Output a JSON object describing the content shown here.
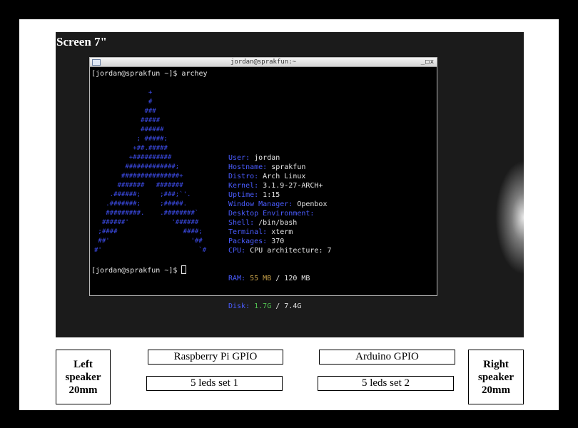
{
  "screen": {
    "label": "Screen 7\""
  },
  "terminal": {
    "title": "jordan@sprakfun:~",
    "controls": {
      "minimize": "_",
      "maximize": "□",
      "close": "x"
    },
    "command_line": "[jordan@sprakfun ~]$ archey",
    "prompt_line": "[jordan@sprakfun ~]$ ",
    "logo_lines": [
      "              +",
      "              #",
      "             ###",
      "            #####",
      "            ######",
      "           ; #####;",
      "          +##.#####",
      "         +##########",
      "        #############;",
      "       ###############+",
      "      #######   #######",
      "    .######;     ;###;`'.",
      "   .#######;     ;#####.",
      "   #########.    .########`",
      "  ######'           '######",
      " ;####                 ####;",
      " ##'                     '##",
      "#'                         `#"
    ],
    "info": [
      {
        "key": "User:",
        "value": "jordan"
      },
      {
        "key": "Hostname:",
        "value": "sprakfun"
      },
      {
        "key": "Distro:",
        "value": "Arch Linux"
      },
      {
        "key": "Kernel:",
        "value": "3.1.9-27-ARCH+"
      },
      {
        "key": "Uptime:",
        "value": "1:15"
      },
      {
        "key": "Window Manager:",
        "value": "Openbox"
      },
      {
        "key": "Desktop Environment:",
        "value": ""
      },
      {
        "key": "Shell:",
        "value": "/bin/bash"
      },
      {
        "key": "Terminal:",
        "value": "xterm"
      },
      {
        "key": "Packages:",
        "value": "370"
      },
      {
        "key": "CPU:",
        "value": "CPU architecture: 7"
      }
    ],
    "ram": {
      "key": "RAM:",
      "used": "55 MB",
      "sep": " / ",
      "total": "120 MB"
    },
    "disk": {
      "key": "Disk:",
      "used": "1.7G",
      "sep": " / ",
      "total": "7.4G"
    },
    "colors": {
      "logo": "#3f4ff2",
      "key": "#4a5cff",
      "ram_used": "#c8a24a",
      "disk_used": "#52c452"
    }
  },
  "boxes": {
    "left_speaker": [
      "Left",
      "speaker",
      "20mm"
    ],
    "right_speaker": [
      "Right",
      "speaker",
      "20mm"
    ],
    "rpi_gpio": "Raspberry Pi GPIO",
    "arduino_gpio": "Arduino GPIO",
    "leds_set_1": "5 leds set 1",
    "leds_set_2": "5 leds set 2"
  }
}
